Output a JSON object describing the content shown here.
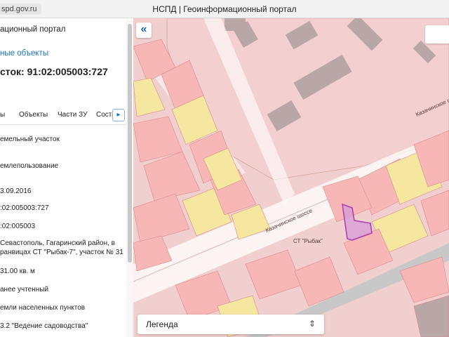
{
  "window": {
    "url": "spd.gov.ru",
    "title": "НСПД | Геоинформационный портал"
  },
  "panel": {
    "portal_title": "ационный портал",
    "link": "ные объекты",
    "heading": "сток: 91:02:005003:727",
    "tabs": [
      "ы",
      "Объекты",
      "Части ЗУ",
      "Соста"
    ],
    "fields": [
      "емельный участок",
      "емлепользование",
      "3.09.2016",
      ":02:005003:727",
      ":02:005003",
      "Севастополь, Гагаринский район, в",
      "ранвицах СТ \"Рыбак-7\", участок № 31",
      "31.00 кв. м",
      "анее учтенный",
      "емли населенных пунктов",
      "3.2 \"Ведение садоводства\""
    ]
  },
  "map": {
    "road_labels": [
      "Казачинское шоссе",
      "Казачинское шоссе"
    ],
    "place_label": "СТ \"Рыбак\"",
    "highlight_color": "#b040b0",
    "parcel_color": "#f7b7b7",
    "yellow_color": "#f5e6a0"
  },
  "legend": {
    "label": "Легенда"
  }
}
